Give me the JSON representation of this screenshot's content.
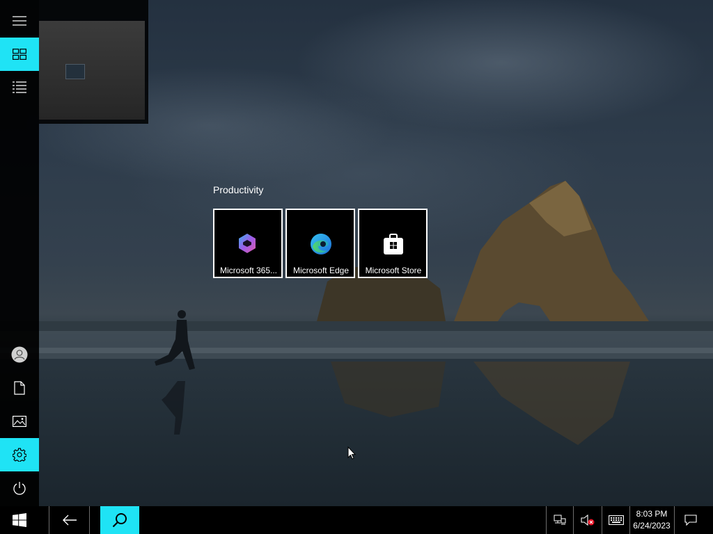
{
  "wallpaper": {
    "name": "windows-10-beach-wallpaper"
  },
  "start_rail": {
    "top_items": [
      {
        "name": "menu-icon",
        "active": false
      },
      {
        "name": "all-apps-tiles-icon",
        "active": true
      },
      {
        "name": "app-list-icon",
        "active": false
      }
    ],
    "bottom_items": [
      {
        "name": "user-account-icon",
        "active": false
      },
      {
        "name": "documents-icon",
        "active": false
      },
      {
        "name": "pictures-icon",
        "active": false
      },
      {
        "name": "settings-gear-icon",
        "active": true
      },
      {
        "name": "power-icon",
        "active": false
      }
    ]
  },
  "start_group": {
    "title": "Productivity",
    "tiles": [
      {
        "label": "Microsoft 365...",
        "icon": "microsoft-365-icon"
      },
      {
        "label": "Microsoft Edge",
        "icon": "edge-icon"
      },
      {
        "label": "Microsoft Store",
        "icon": "store-icon"
      }
    ]
  },
  "taskbar": {
    "start_icon": "windows-logo-icon",
    "back_icon": "back-arrow-icon",
    "search_icon": "search-icon",
    "tray": [
      "network-icon",
      "volume-muted-icon",
      "touch-keyboard-icon"
    ],
    "time": "8:03 PM",
    "date": "6/24/2023",
    "notifications_icon": "action-center-icon"
  },
  "colors": {
    "accent": "#1fe3f5",
    "taskbar": "#000000"
  }
}
